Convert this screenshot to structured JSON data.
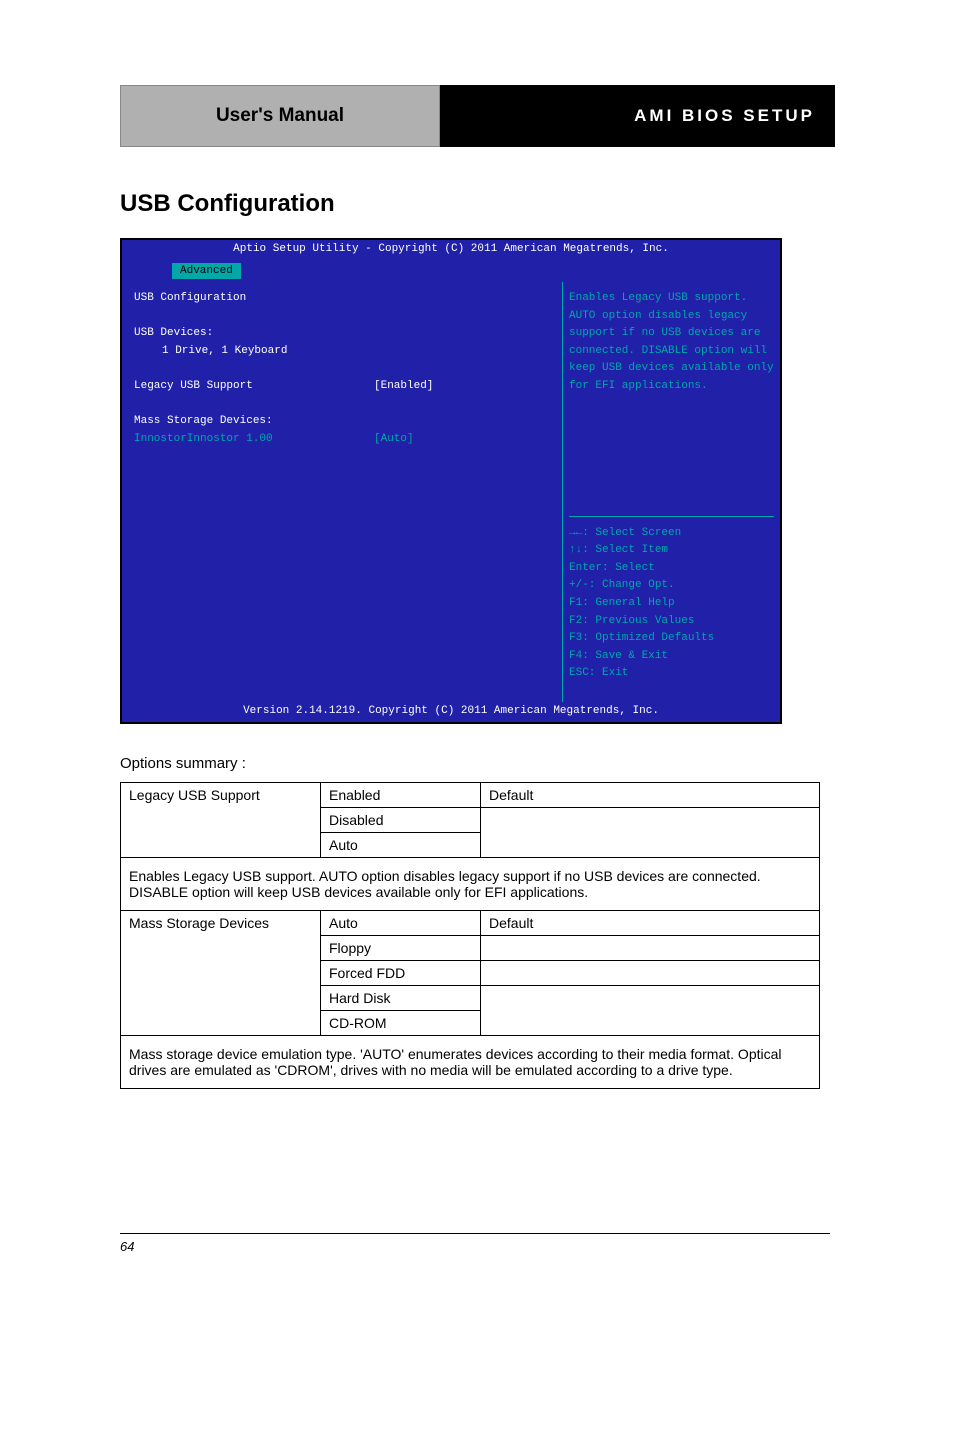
{
  "header": {
    "left": "User's Manual",
    "right": "AMI BIOS SETUP"
  },
  "section_title": "USB Configuration",
  "bios": {
    "top": "Aptio Setup Utility - Copyright (C) 2011 American Megatrends, Inc.",
    "tab": "Advanced",
    "heading": "USB Configuration",
    "devices_label": "USB Devices:",
    "devices_value": "1 Drive, 1 Keyboard",
    "legacy_label": "Legacy USB Support",
    "legacy_value": "[Enabled]",
    "mass_label": "Mass Storage Devices:",
    "mass_item_label": "InnostorInnostor 1.00",
    "mass_item_value": "[Auto]",
    "help": "Enables Legacy USB support. AUTO option disables legacy support if no USB devices are connected. DISABLE option will keep USB devices available only for EFI applications.",
    "keys": {
      "k1": "→←: Select Screen",
      "k2": "↑↓: Select Item",
      "k3": "Enter: Select",
      "k4": "+/-: Change Opt.",
      "k5": "F1: General Help",
      "k6": "F2: Previous Values",
      "k7": "F3: Optimized Defaults",
      "k8": "F4: Save & Exit",
      "k9": "ESC: Exit"
    },
    "bottom": "Version 2.14.1219. Copyright (C) 2011 American Megatrends, Inc."
  },
  "options_label": "Options summary :",
  "table": {
    "row1": {
      "c1": "Legacy USB Support",
      "c2a": "Enabled",
      "c2b": "Disabled",
      "c2c": "Auto",
      "c3a": "Default",
      "c3b": "",
      "c3c": ""
    },
    "row2_span": "Enables Legacy USB support. AUTO option disables legacy support if no USB devices are connected. DISABLE option will keep USB devices available only for EFI applications.",
    "row3": {
      "c1": "Mass Storage Devices",
      "c2a": "Auto",
      "c2b": "Floppy",
      "c2c": "Forced FDD",
      "c2d": "Hard Disk",
      "c2e": "CD-ROM",
      "c3a": "Default",
      "c3b": "",
      "c3c": "",
      "c3d": "",
      "c3e": ""
    },
    "row4_span": "Mass storage device emulation type. 'AUTO' enumerates devices according to their media format. Optical drives are emulated as 'CDROM', drives with no media will be emulated according to a drive type."
  },
  "page_num": "64"
}
